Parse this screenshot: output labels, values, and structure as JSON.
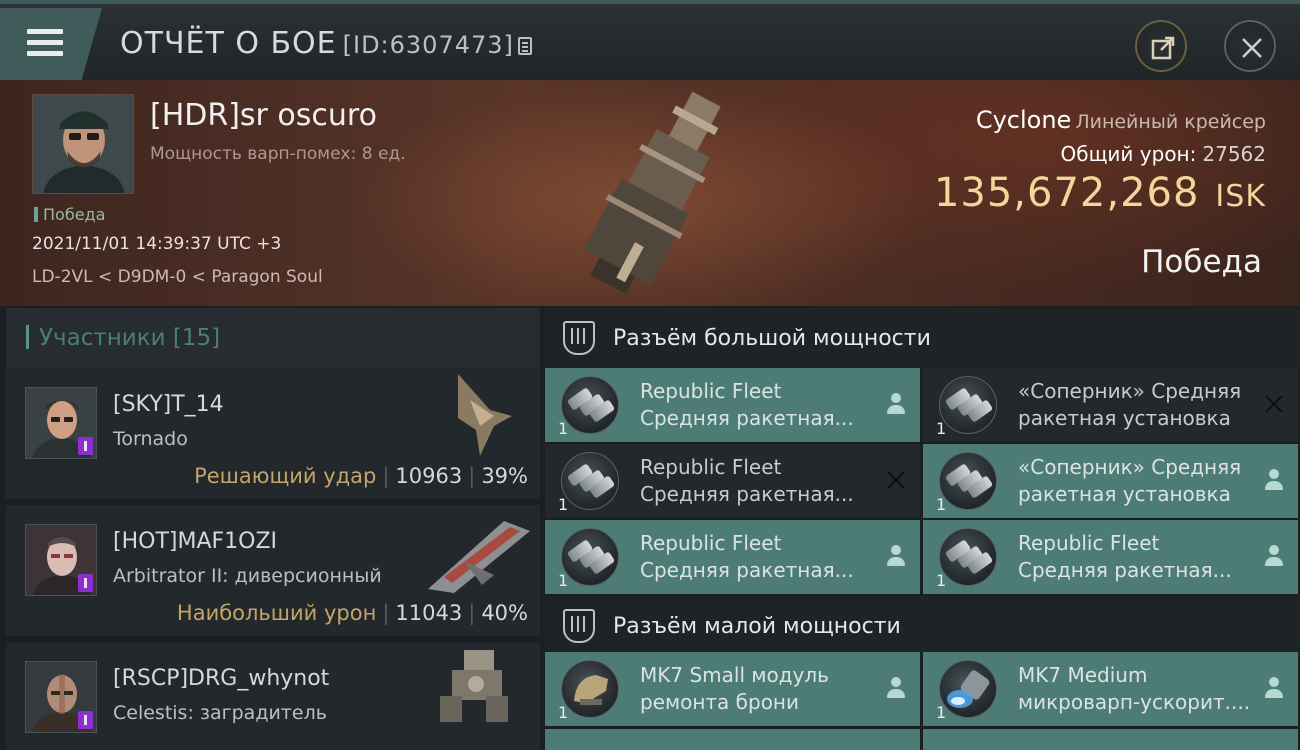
{
  "header": {
    "title": "ОТЧЁТ О БОЕ",
    "report_id": "[ID:6307473]",
    "menu_icon": "hamburger-icon",
    "share_icon": "share-icon",
    "close_icon": "close-icon"
  },
  "victim": {
    "name": "[HDR]sr oscuro",
    "warp_disruption": "Мощность варп-помех: 8 ед.",
    "status_tag": "Победа",
    "datetime": "2021/11/01 14:39:37 UTC +3",
    "location": "LD-2VL < D9DM-0 < Paragon Soul",
    "ship_name": "Cyclone",
    "ship_class": "Линейный крейсер",
    "total_damage_label": "Общий урон:",
    "total_damage": "27562",
    "isk_value": "135,672,268",
    "isk_unit": "ISK",
    "outcome": "Победа"
  },
  "participants": {
    "title": "Участники [15]",
    "items": [
      {
        "name": "[SKY]T_14",
        "ship": "Tornado",
        "tag": "Решающий удар",
        "damage": "10963",
        "percent": "39%"
      },
      {
        "name": "[HOT]MAF1OZI",
        "ship": "Arbitrator II: диверсионный",
        "tag": "Наибольший урон",
        "damage": "11043",
        "percent": "40%"
      },
      {
        "name": "[RSCP]DRG_whynot",
        "ship": "Celestis: заградитель",
        "tag": "",
        "damage": "",
        "percent": ""
      }
    ]
  },
  "fitting": {
    "high_slots_title": "Разъём большой мощности",
    "low_slots_title": "Разъём малой мощности",
    "high_slots": [
      {
        "qty": "1",
        "line1": "Republic Fleet",
        "line2": "Средняя ракетная...",
        "state": "person-icon",
        "active": true
      },
      {
        "qty": "1",
        "line1": "«Соперник» Средняя",
        "line2": "ракетная установка",
        "state": "x-icon",
        "active": false
      },
      {
        "qty": "1",
        "line1": "Republic Fleet",
        "line2": "Средняя ракетная...",
        "state": "x-icon",
        "active": false
      },
      {
        "qty": "1",
        "line1": "«Соперник» Средняя",
        "line2": "ракетная установка",
        "state": "person-icon",
        "active": true
      },
      {
        "qty": "1",
        "line1": "Republic Fleet",
        "line2": "Средняя ракетная...",
        "state": "person-icon",
        "active": true
      },
      {
        "qty": "1",
        "line1": "Republic Fleet",
        "line2": "Средняя ракетная...",
        "state": "person-icon",
        "active": true
      }
    ],
    "low_slots": [
      {
        "qty": "1",
        "line1": "MK7 Small модуль",
        "line2": "ремонта брони",
        "state": "person-icon",
        "active": true
      },
      {
        "qty": "1",
        "line1": "MK7 Medium",
        "line2": "микроварп-ускорит....",
        "state": "person-icon",
        "active": true
      }
    ]
  },
  "colors": {
    "accent_teal": "#4d7c76",
    "isk_gold": "#f5d59a",
    "tag_gold": "#c4a566",
    "badge_purple": "#8c2ed0"
  }
}
